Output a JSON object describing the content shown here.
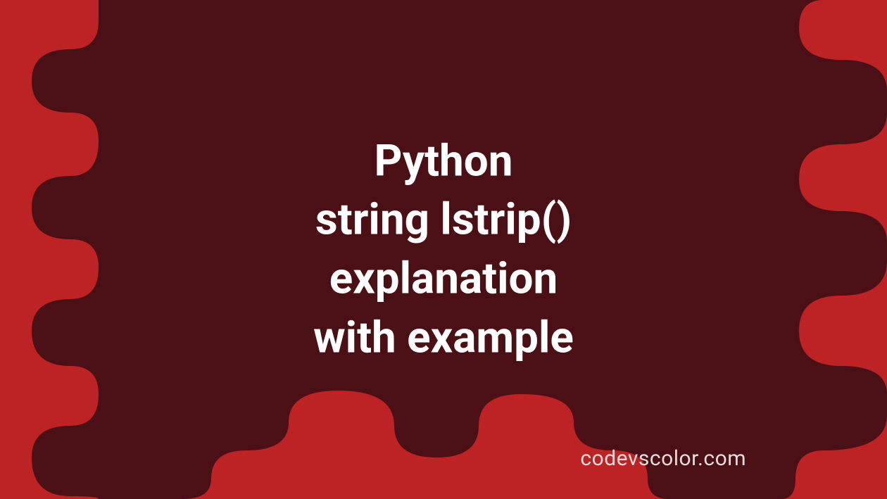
{
  "title_lines": [
    "Python",
    "string lstrip()",
    "explanation",
    "with example"
  ],
  "watermark": "codevscolor.com",
  "colors": {
    "background": "#bd2225",
    "blob": "#4a1015",
    "text": "#ffffff",
    "watermark": "#e6dcdc"
  }
}
